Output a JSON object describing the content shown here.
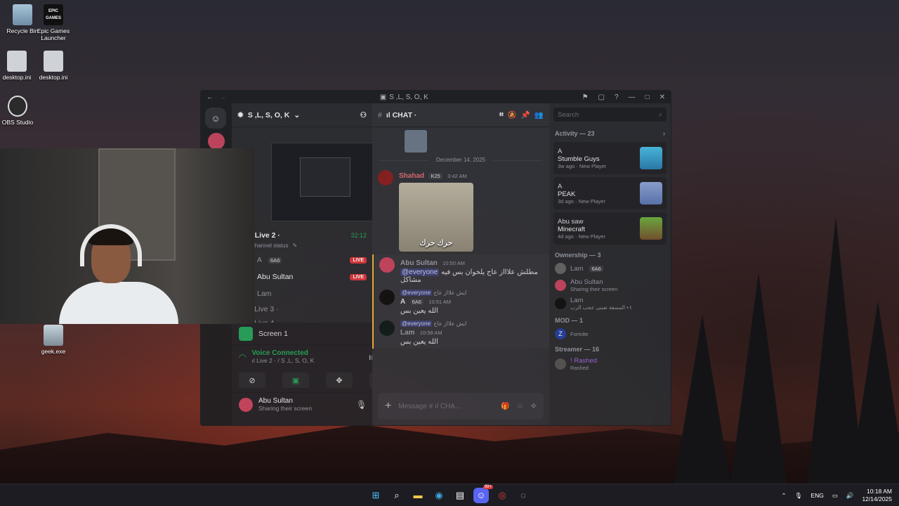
{
  "desktop": {
    "icons": [
      {
        "label": "Recycle Bin"
      },
      {
        "label": "Epic Games Launcher"
      },
      {
        "label": "desktop.ini"
      },
      {
        "label": "desktop.ini"
      },
      {
        "label": "OBS Studio"
      },
      {
        "label": "geek.exe"
      }
    ],
    "epic_logo_text": "EPIC GAMES"
  },
  "window": {
    "title": "S ,L, S, O, K",
    "server_name": "S ,L, S, O, K",
    "channel_name": "ıl CHAT ·"
  },
  "channels": {
    "live_channel": "ıl Live 2 ·",
    "live_time": "32:12",
    "status_placeholder": "Set a channel status",
    "users": [
      {
        "name": "A",
        "tag": "6A6",
        "live": "LIVE"
      },
      {
        "name": "Abu Sultan",
        "live": "LIVE"
      },
      {
        "name": "Lam"
      }
    ],
    "other_channels": [
      "ıl Live 3 ·",
      "ıl Live 4 ·"
    ]
  },
  "voice": {
    "screen_label": "Screen 1",
    "status": "Voice Connected",
    "location": "ıl Live 2 · / S ,L, S, O, K",
    "user_name": "Abu Sultan",
    "user_status": "Sharing their screen"
  },
  "chat": {
    "date_divider": "December 14, 2025",
    "messages": [
      {
        "author": "Shahad",
        "tag": "K25",
        "time": "3:42 AM",
        "image_caption": "حرك حرك"
      },
      {
        "author": "Abu Sultan",
        "time": "10:50 AM",
        "mention": "@everyone",
        "text": "مطلش علاااز عاج يلخوان بس فيه مشاكل"
      },
      {
        "author": "A",
        "tag": "6A6",
        "time": "10:51 AM",
        "reply": "ايش علااز عاج",
        "mention": "@everyone",
        "text": "الله يعين بس"
      },
      {
        "author": "Lam",
        "time": "10:58 AM",
        "reply": "ايش علااز عاج",
        "mention": "@everyone",
        "text": "الله يعين بس"
      }
    ],
    "composer_placeholder": "Message # ıl CHA..."
  },
  "members": {
    "search_placeholder": "Search",
    "activity_header": "Activity — 23",
    "activities": [
      {
        "user": "A",
        "game": "Stumble Guys",
        "meta": "3w ago",
        "meta2": "New Player"
      },
      {
        "user": "A",
        "game": "PEAK",
        "meta": "3d ago",
        "meta2": "New Player"
      },
      {
        "user": "Abu saw",
        "game": "Minecraft",
        "meta": "4d ago",
        "meta2": "New Player"
      }
    ],
    "ownership_header": "Ownership — 3",
    "owners": [
      {
        "name": "Lam",
        "tag": "6A6"
      },
      {
        "name": "Abu Sultan",
        "sub": "Sharing their screen"
      },
      {
        "name": "Lam",
        "sub": "المسعة تعبنى عجب الرب • t"
      }
    ],
    "mod_header": "MOD — 1",
    "mods": [
      {
        "name": "Z",
        "sub": "Fortnite"
      }
    ],
    "streamer_header": "Streamer — 16",
    "streamers": [
      {
        "name": "! Rashed",
        "sub": "Rashed"
      }
    ]
  },
  "taskbar": {
    "lang": "ENG",
    "time": "10:18 AM",
    "date": "12/14/2025",
    "badge": "99+"
  }
}
